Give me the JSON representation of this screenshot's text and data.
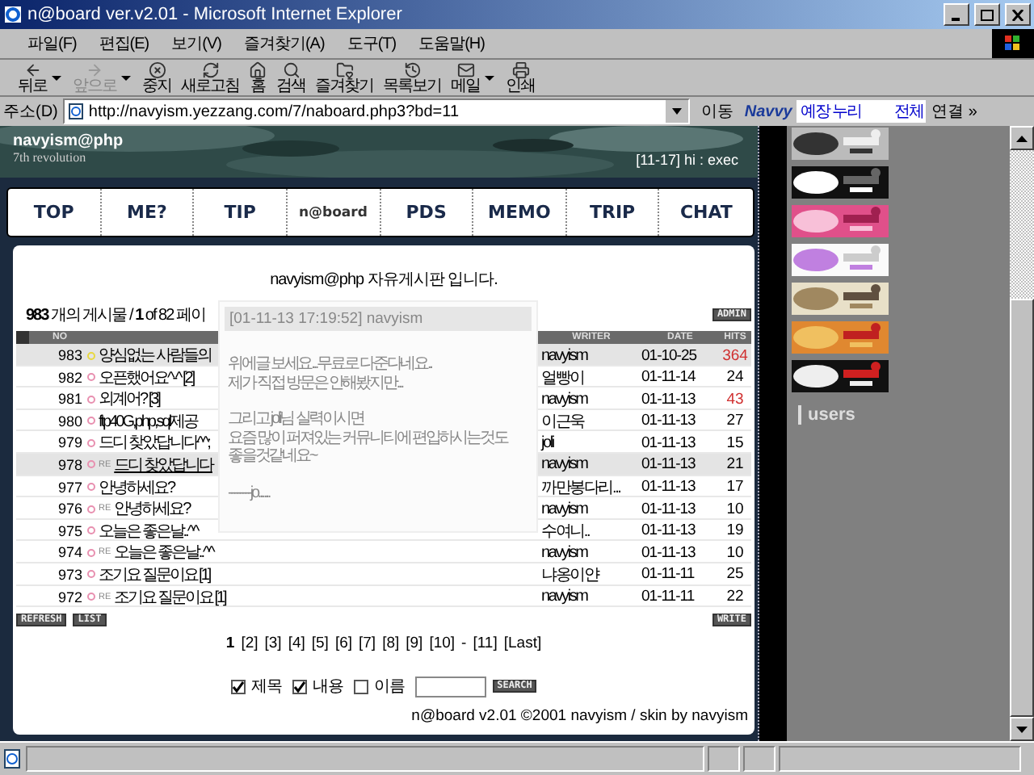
{
  "window": {
    "title": "n@board ver.v2.01 - Microsoft Internet Explorer"
  },
  "menu": [
    "파일(F)",
    "편집(E)",
    "보기(V)",
    "즐겨찾기(A)",
    "도구(T)",
    "도움말(H)"
  ],
  "toolbar": [
    {
      "label": "뒤로",
      "disabled": false,
      "dropdown": true
    },
    {
      "label": "앞으로",
      "disabled": true,
      "dropdown": true
    },
    {
      "label": "중지",
      "disabled": false,
      "dropdown": false
    },
    {
      "label": "새로고침",
      "disabled": false,
      "dropdown": false
    },
    {
      "label": "홈",
      "disabled": false,
      "dropdown": false
    },
    {
      "label": "검색",
      "disabled": false,
      "dropdown": false
    },
    {
      "label": "즐겨찾기",
      "disabled": false,
      "dropdown": false
    },
    {
      "label": "목록보기",
      "disabled": false,
      "dropdown": false
    },
    {
      "label": "메일",
      "disabled": false,
      "dropdown": true
    },
    {
      "label": "인쇄",
      "disabled": false,
      "dropdown": false
    }
  ],
  "address": {
    "label": "주소(D)",
    "url": "http://navyism.yezzang.com/7/naboard.php3?bd=11",
    "go": "이동"
  },
  "links_bar": {
    "logo": "Navvy",
    "field": "예장 누리",
    "scope": "전체",
    "label": "연결",
    "more": "»"
  },
  "site": {
    "name": "navyism@php",
    "subtitle": "7th revolution",
    "status": "[11-17] hi : exec",
    "nav": [
      {
        "label": "TOP",
        "selected": false
      },
      {
        "label": "ME?",
        "selected": false
      },
      {
        "label": "TIP",
        "selected": false
      },
      {
        "label": "n@board",
        "selected": true
      },
      {
        "label": "PDS",
        "selected": false
      },
      {
        "label": "MEMO",
        "selected": false
      },
      {
        "label": "TRIP",
        "selected": false
      },
      {
        "label": "CHAT",
        "selected": false
      }
    ]
  },
  "board": {
    "title": "navyism@php 자유게시판 입니다.",
    "count": "**983** 개의 게시물 / **1** of 82 페이",
    "admin": "ADMIN",
    "columns": [
      "NO",
      "WRITER",
      "DATE",
      "HITS"
    ],
    "rows": [
      {
        "no": "983",
        "title": "양심없는 사람들의",
        "writer": "navyism",
        "date": "01-10-25",
        "hits": "364",
        "hot": true,
        "highlighted": true,
        "hover": false,
        "color": "#e8d840"
      },
      {
        "no": "982",
        "title": "오픈했어요^-^ [2]",
        "writer": "얼빵이",
        "date": "01-11-14",
        "hits": "24",
        "hot": false,
        "highlighted": false,
        "hover": false,
        "color": "#e890b0"
      },
      {
        "no": "981",
        "title": "외계어? [3]",
        "writer": "navyism",
        "date": "01-11-13",
        "hits": "43",
        "hot": true,
        "highlighted": false,
        "hover": false,
        "color": "#e890b0"
      },
      {
        "no": "980",
        "title": "ftp40G,php,sql제공",
        "writer": "이근욱",
        "date": "01-11-13",
        "hits": "27",
        "hot": false,
        "highlighted": false,
        "hover": false,
        "color": "#e890b0"
      },
      {
        "no": "979",
        "title": "드디 찾았답니다^^;",
        "writer": "joli",
        "date": "01-11-13",
        "hits": "15",
        "hot": false,
        "highlighted": false,
        "hover": false,
        "color": "#e890b0"
      },
      {
        "no": "978",
        "prefix": "RE",
        "title": "드디 찾았답니다",
        "writer": "navyism",
        "date": "01-11-13",
        "hits": "21",
        "hot": false,
        "highlighted": true,
        "hover": true,
        "color": "#e890b0"
      },
      {
        "no": "977",
        "title": "안녕하세요?",
        "writer": "까만봉다리...",
        "date": "01-11-13",
        "hits": "17",
        "hot": false,
        "highlighted": false,
        "hover": false,
        "color": "#e890b0"
      },
      {
        "no": "976",
        "prefix": "RE",
        "title": "안녕하세요?",
        "writer": "navyism",
        "date": "01-11-13",
        "hits": "10",
        "hot": false,
        "highlighted": false,
        "hover": false,
        "color": "#e890b0"
      },
      {
        "no": "975",
        "title": "오늘은 좋은날..^^",
        "writer": "수여니..",
        "date": "01-11-13",
        "hits": "19",
        "hot": false,
        "highlighted": false,
        "hover": false,
        "color": "#e890b0"
      },
      {
        "no": "974",
        "prefix": "RE",
        "title": "오늘은 좋은날..^^",
        "writer": "navyism",
        "date": "01-11-13",
        "hits": "10",
        "hot": false,
        "highlighted": false,
        "hover": false,
        "color": "#e890b0"
      },
      {
        "no": "973",
        "title": "조기요 질문이요 [1]",
        "writer": "냐옹이얀",
        "date": "01-11-11",
        "hits": "25",
        "hot": false,
        "highlighted": false,
        "hover": false,
        "color": "#e890b0"
      },
      {
        "no": "972",
        "prefix": "RE",
        "title": "조기요 질문이요 [1]",
        "writer": "navyism",
        "date": "01-11-11",
        "hits": "22",
        "hot": false,
        "highlighted": false,
        "hover": false,
        "color": "#e890b0"
      }
    ],
    "left_buttons": [
      "REFRESH",
      "LIST"
    ],
    "write": "WRITE",
    "pages": [
      {
        "label": "1",
        "selected": true
      },
      {
        "label": "[2]",
        "selected": false
      },
      {
        "label": "[3]",
        "selected": false
      },
      {
        "label": "[4]",
        "selected": false
      },
      {
        "label": "[5]",
        "selected": false
      },
      {
        "label": "[6]",
        "selected": false
      },
      {
        "label": "[7]",
        "selected": false
      },
      {
        "label": "[8]",
        "selected": false
      },
      {
        "label": "[9]",
        "selected": false
      },
      {
        "label": "[10]",
        "selected": false
      },
      {
        "label": "-",
        "selected": false
      },
      {
        "label": "[11]",
        "selected": false
      },
      {
        "label": "[Last]",
        "selected": false
      }
    ],
    "search": {
      "options": [
        {
          "label": "제목",
          "checked": true
        },
        {
          "label": "내용",
          "checked": true
        },
        {
          "label": "이름",
          "checked": false
        }
      ],
      "button": "SEARCH"
    },
    "footer": "n@board v2.01 ©2001 navyism / skin by navyism"
  },
  "tooltip": {
    "header": "[01-11-13 17:19:52] navyism",
    "paragraphs": [
      [
        "위에글 보세요...무료로 다준다네요..",
        "제가 직접 방문은 안해봤지만..."
      ],
      [
        "그리고 joli님 실력이시면",
        "요즘 많이 퍼져있는 커뮤니티에 편입하시는것도",
        "좋을것같네요~"
      ],
      [
        "--------jo......"
      ]
    ]
  },
  "sidebar": {
    "users": "users"
  }
}
